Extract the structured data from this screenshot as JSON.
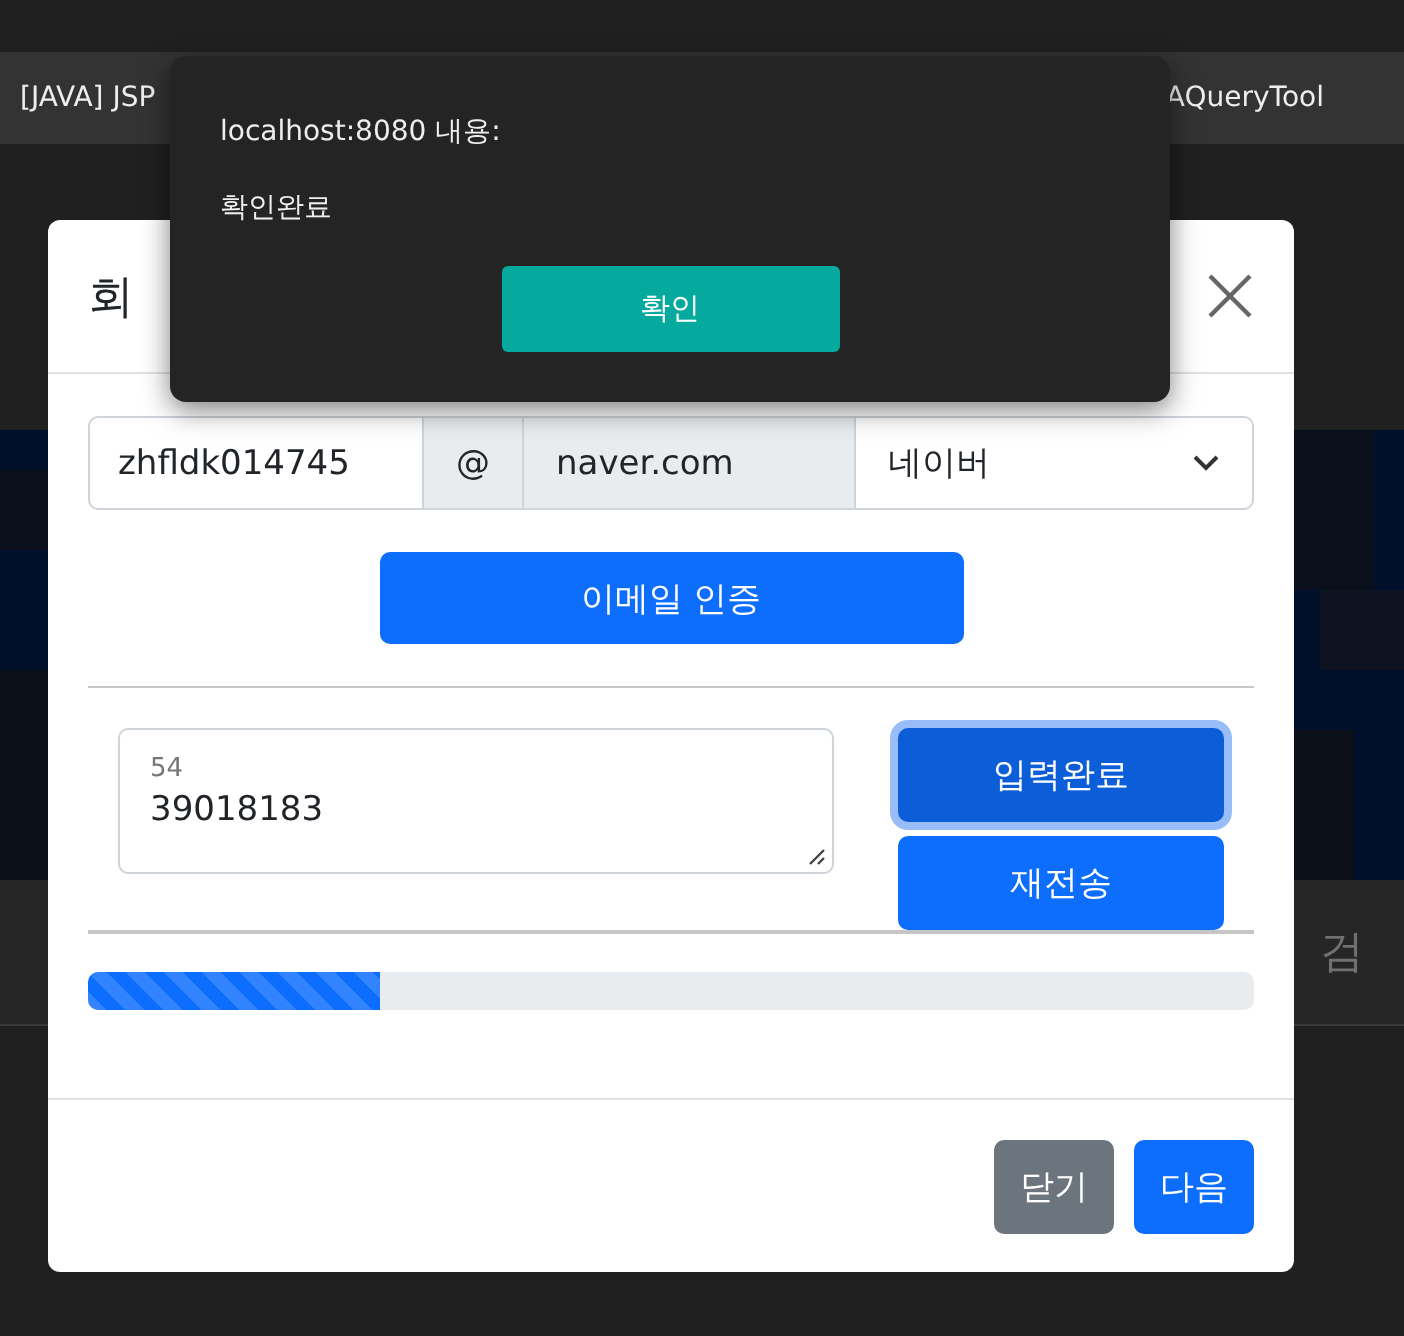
{
  "browser_tabs": [
    {
      "label": "[JAVA] JSP"
    },
    {
      "label": "AQueryTool"
    }
  ],
  "background_text": "검",
  "modal": {
    "title": "회",
    "email": {
      "id_value": "zhfldk014745",
      "at": "@",
      "domain_value": "naver.com",
      "domain_select": "네이버"
    },
    "verify_button": "이메일 인증",
    "code": {
      "label": "54",
      "value": "39018183"
    },
    "code_buttons": [
      {
        "label": "입력완료",
        "focused": true
      },
      {
        "label": "재전송",
        "focused": false
      }
    ],
    "progress": {
      "level": 0.25
    },
    "footer_buttons": [
      {
        "label": "닫기",
        "kind": "secondary"
      },
      {
        "label": "다음",
        "kind": "primary"
      }
    ]
  },
  "alert": {
    "origin": "localhost:8080 내용:",
    "message": "확인완료",
    "button": "확인"
  }
}
